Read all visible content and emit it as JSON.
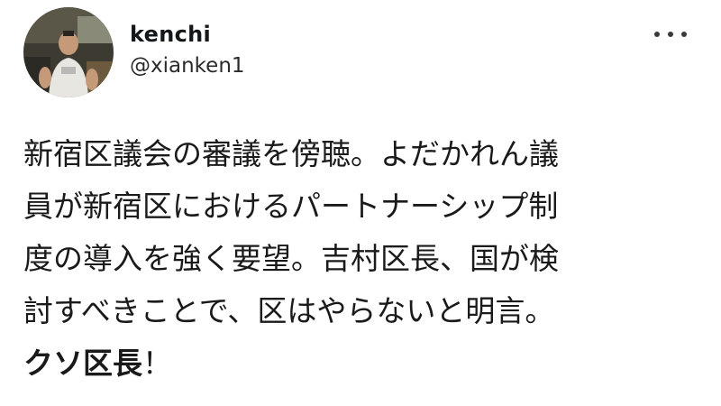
{
  "user": {
    "display_name": "kenchi",
    "handle": "@xianken1",
    "avatar_icon": "profile-photo"
  },
  "menu_icon": "more-options-icon",
  "tweet": {
    "lines": [
      "新宿区議会の審議を傍聴。よだかれん議",
      "員が新宿区におけるパートナーシップ制",
      "度の導入を強く要望。吉村区長、国が検",
      "討すべきことで、区はやらないと明言。"
    ],
    "emphasis": "クソ区長",
    "emphasis_suffix": "！"
  }
}
